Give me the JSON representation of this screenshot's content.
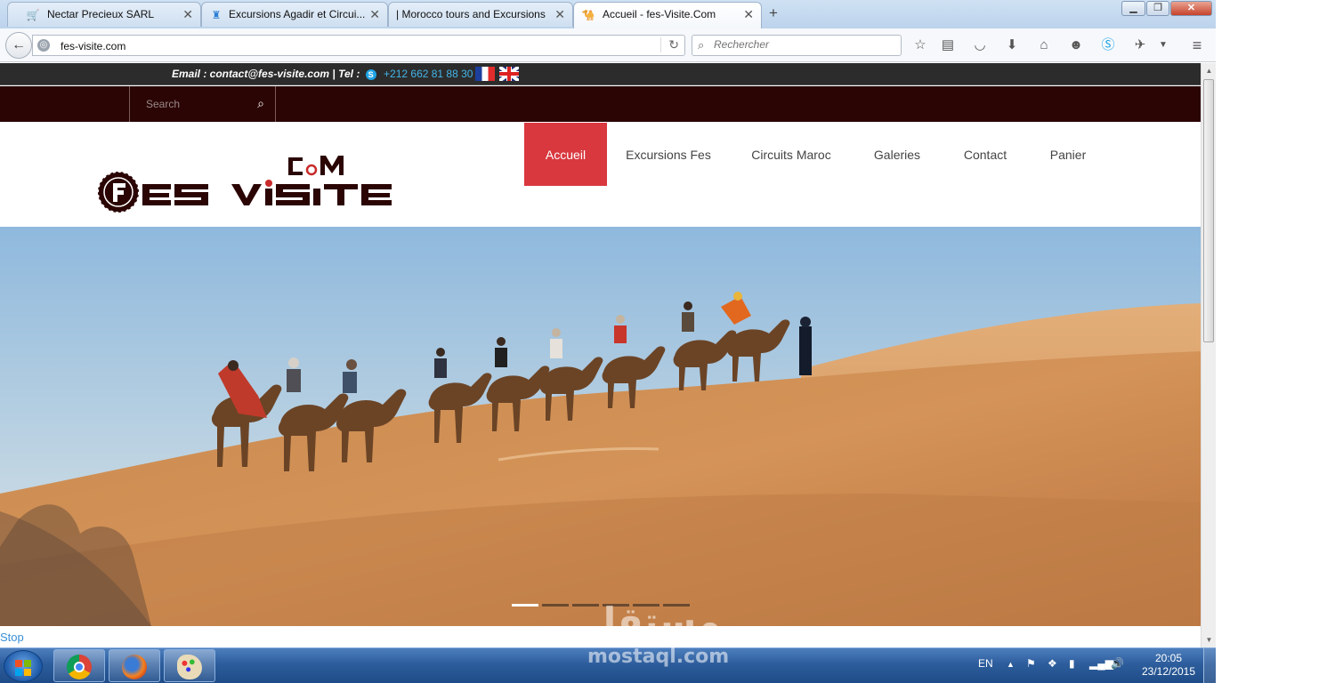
{
  "browser": {
    "tabs": [
      {
        "title": "Nectar Precieux SARL",
        "icon": "cart-icon"
      },
      {
        "title": "Excursions Agadir et Circui...",
        "icon": "castle-icon"
      },
      {
        "title": "| Morocco tours and Excursions",
        "icon": ""
      },
      {
        "title": "Accueil - fes-Visite.Com",
        "icon": "camel-icon",
        "active": true
      }
    ],
    "url": "fes-visite.com",
    "search_placeholder": "Rechercher",
    "window_controls": [
      "minimize",
      "maximize",
      "close"
    ],
    "toolbar_icons": [
      "star-icon",
      "reading-list-icon",
      "pocket-icon",
      "download-icon",
      "home-icon",
      "chat-icon",
      "skype-icon",
      "extension-icon",
      "dropdown-icon",
      "menu-icon"
    ]
  },
  "site": {
    "contact_email": "Email : contact@fes-visite.com | Tel :",
    "contact_phone": "+212 662 81 88 30",
    "search_placeholder": "Search",
    "logo": {
      "main": "FES VISITE",
      "sub": "COM"
    },
    "nav": [
      {
        "label": "Accueil",
        "active": true
      },
      {
        "label": "Excursions Fes"
      },
      {
        "label": "Circuits Maroc"
      },
      {
        "label": "Galeries"
      },
      {
        "label": "Contact"
      },
      {
        "label": "Panier"
      }
    ],
    "slider": {
      "slide_count": 6,
      "active_index": 0
    },
    "colors": {
      "topbar": "#2c2c2c",
      "darkbar": "#2b0404",
      "nav_active": "#d9383f",
      "link": "#43b5e8"
    }
  },
  "status": {
    "text": "Stop"
  },
  "watermark": {
    "arabic": "مستقل",
    "latin": "mostaql.com"
  },
  "taskbar": {
    "apps": [
      "chrome-icon",
      "firefox-icon",
      "paint-icon"
    ],
    "language": "EN",
    "time": "20:05",
    "date": "23/12/2015"
  }
}
